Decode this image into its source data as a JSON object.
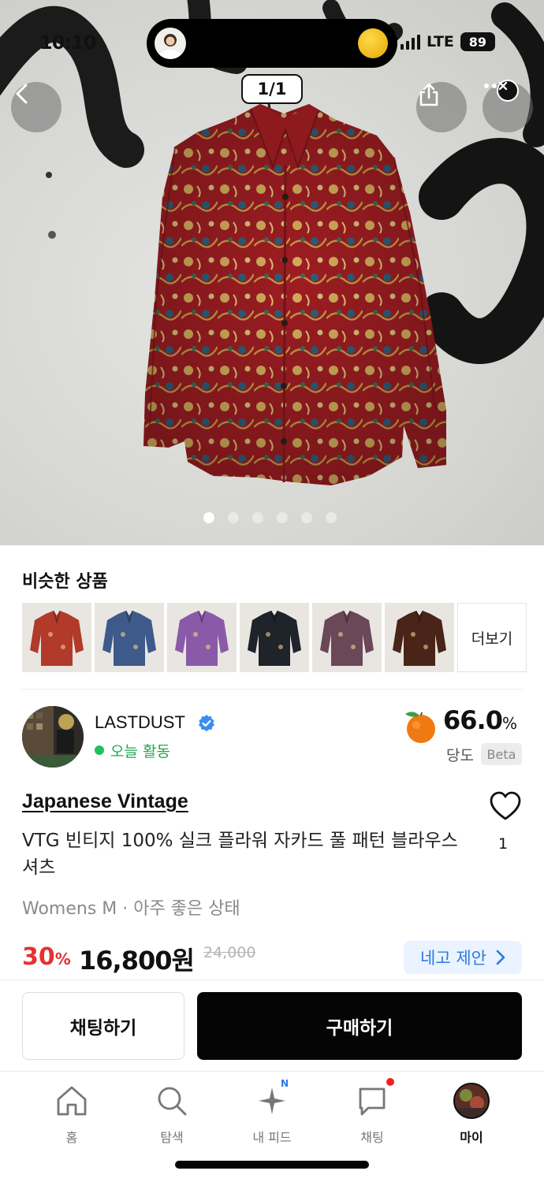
{
  "status_bar": {
    "time": "10:10",
    "network": "LTE",
    "battery": "89"
  },
  "gallery": {
    "counter": "1/1",
    "dot_count": 6,
    "active_dot": 0
  },
  "similar": {
    "title": "비슷한 상품",
    "more_label": "더보기",
    "thumb_colors": [
      "#b13a2a",
      "#3d5a8a",
      "#8a5aa8",
      "#1f232a",
      "#6a4858",
      "#4a2418"
    ]
  },
  "seller": {
    "name": "LASTDUST",
    "activity": "오늘 활동",
    "sweetness_value": "66.0",
    "sweetness_unit": "%",
    "sweetness_label": "당도",
    "beta_label": "Beta"
  },
  "product": {
    "brand": "Japanese Vintage",
    "title": "VTG 빈티지 100% 실크 플라워 자카드 풀 패턴 블라우스 셔츠",
    "meta": "Womens M · 아주 좋은 상태",
    "like_count": "1",
    "discount": "30",
    "discount_unit": "%",
    "price": "16,800원",
    "original_price": "24,000",
    "offer_label": "네고 제안"
  },
  "actions": {
    "chat_label": "채팅하기",
    "buy_label": "구매하기"
  },
  "nav": [
    {
      "label": "홈",
      "icon": "home-icon"
    },
    {
      "label": "탐색",
      "icon": "search-icon"
    },
    {
      "label": "내 피드",
      "icon": "sparkle-icon",
      "badge": "N"
    },
    {
      "label": "채팅",
      "icon": "chat-icon"
    },
    {
      "label": "마이",
      "icon": "profile-avatar"
    }
  ],
  "colors": {
    "discount_red": "#e53131",
    "offer_blue": "#2a7ae2",
    "active_green": "#20c05c",
    "buy_black": "#050505"
  }
}
